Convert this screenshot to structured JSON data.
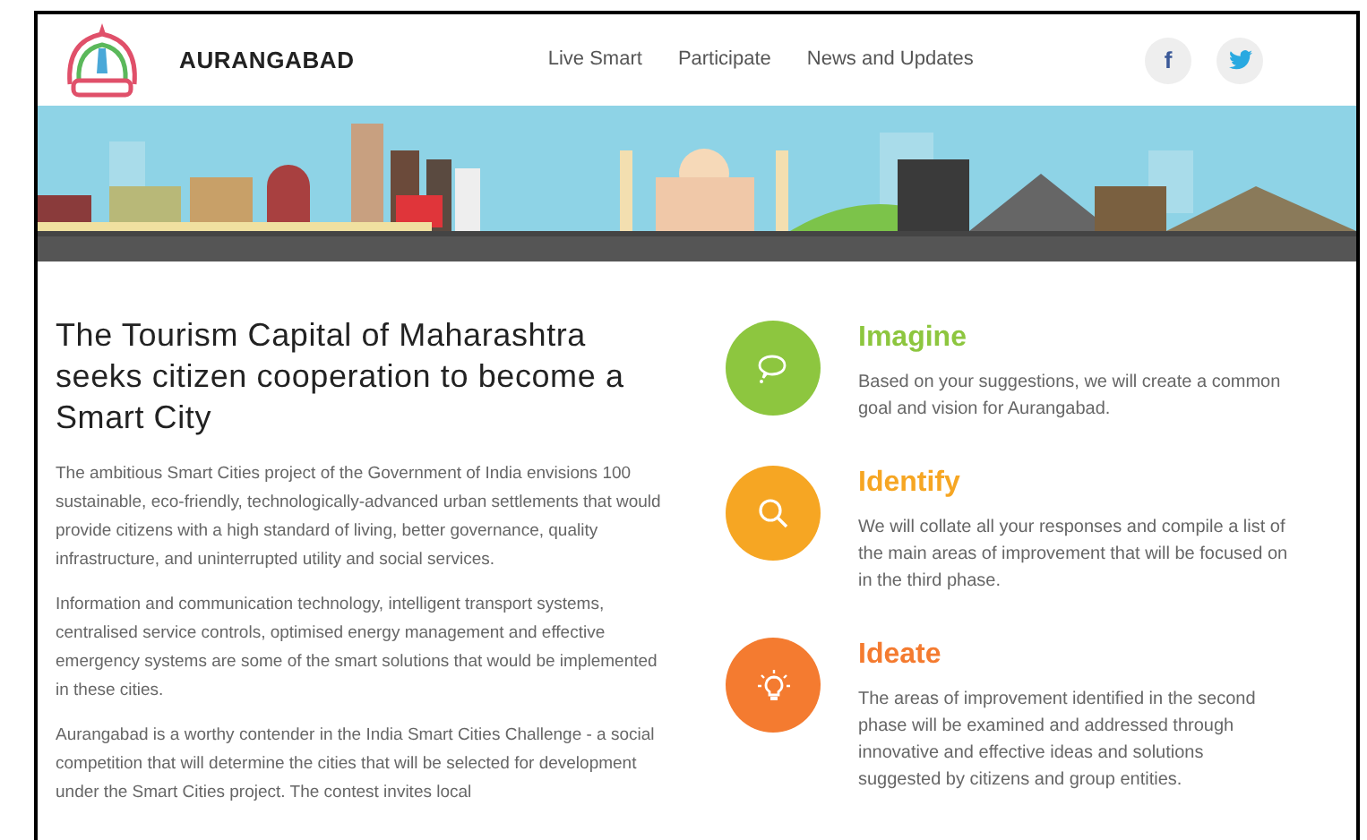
{
  "header": {
    "brand": "AURANGABAD",
    "nav": [
      {
        "label": "Live Smart"
      },
      {
        "label": "Participate"
      },
      {
        "label": "News and Updates"
      }
    ],
    "social": [
      {
        "kind": "facebook",
        "label": "f"
      },
      {
        "kind": "twitter"
      }
    ]
  },
  "intro": {
    "heading": "The Tourism Capital of Maharashtra seeks citizen cooperation to become a Smart City",
    "paragraphs": [
      "The ambitious Smart Cities project of the Government of India envisions 100 sustainable, eco-friendly, technologically-advanced urban settlements that would provide citizens with a high standard of living, better governance, quality infrastructure, and uninterrupted utility and social services.",
      "Information and communication technology, intelligent transport systems, centralised service controls, optimised energy management and effective emergency systems are some of the smart solutions that would be implemented in these cities.",
      "Aurangabad is a worthy contender in the India Smart Cities Challenge - a social competition that will determine the cities that will be selected for development under the Smart Cities project. The contest invites local"
    ]
  },
  "steps": [
    {
      "kind": "imagine",
      "title": "Imagine",
      "color": "#8dc63f",
      "text": "Based on your suggestions, we will create a common goal and vision for Aurangabad."
    },
    {
      "kind": "identify",
      "title": "Identify",
      "color": "#f6a623",
      "text": "We will collate all your responses and compile a list of the main areas of improvement that will be focused on in the third phase."
    },
    {
      "kind": "ideate",
      "title": "Ideate",
      "color": "#f47b30",
      "text": "The areas of improvement identified in the second phase will be examined and addressed through innovative and effective ideas and solutions suggested by citizens and group entities."
    }
  ]
}
